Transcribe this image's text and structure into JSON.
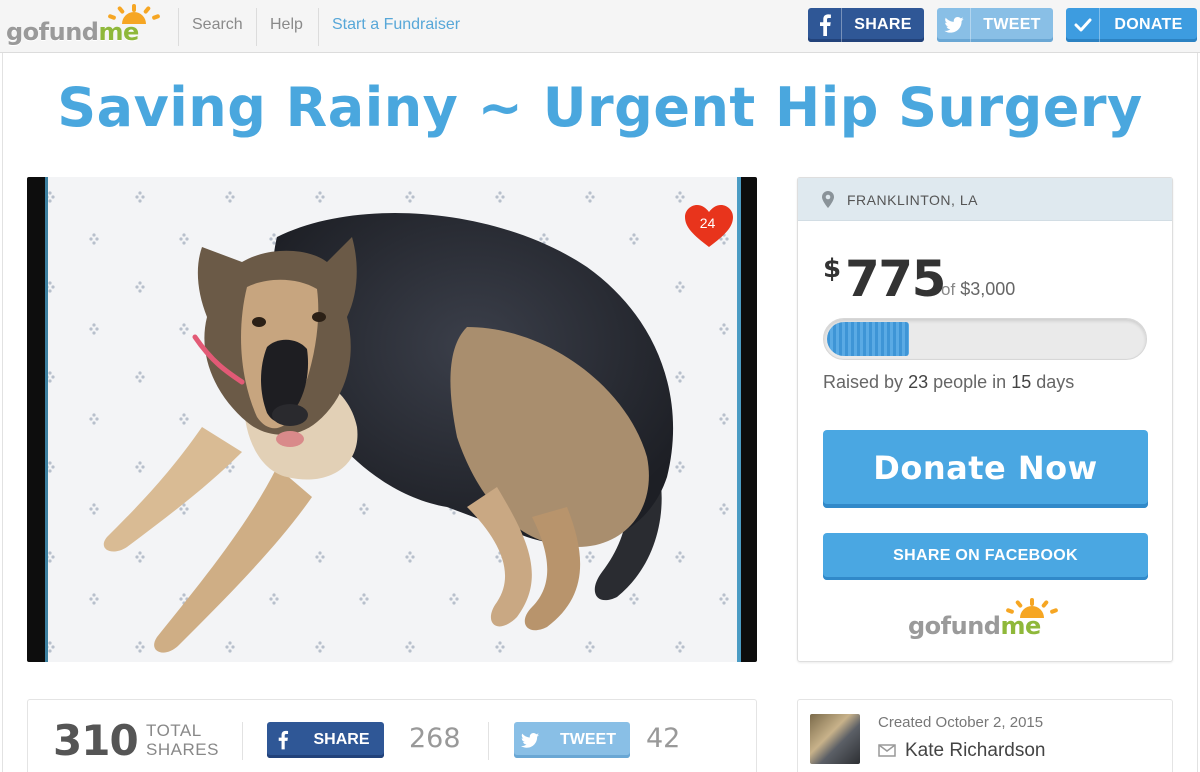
{
  "nav": {
    "logo_text_a": "gofund",
    "logo_text_b": "me",
    "links": [
      "Search",
      "Help",
      "Start a Fundraiser"
    ],
    "share_label": "SHARE",
    "tweet_label": "TWEET",
    "donate_label": "DONATE"
  },
  "campaign": {
    "title": "Saving Rainy ~ Urgent Hip Surgery",
    "hearts": "24",
    "location": "FRANKLINTON, LA",
    "raised_amount": "775",
    "goal_of": "of",
    "goal": "$3,000",
    "progress_fraction": 0.258,
    "raised_by_prefix": "Raised by",
    "people_count": "23",
    "people_mid": "people in",
    "days_count": "15",
    "days_suffix": "days",
    "donate_button": "Donate Now",
    "share_facebook_button": "SHARE ON FACEBOOK"
  },
  "shares": {
    "total": "310",
    "total_label_1": "TOTAL",
    "total_label_2": "SHARES",
    "fb_label": "SHARE",
    "fb_count": "268",
    "tw_label": "TWEET",
    "tw_count": "42"
  },
  "organizer": {
    "created": "Created October 2, 2015",
    "name": "Kate Richardson"
  },
  "colors": {
    "brand_blue": "#4aa7e2",
    "facebook": "#2f5796",
    "twitter": "#89bfe6",
    "logo_green": "#8fb83a",
    "logo_sun": "#f6a623",
    "heart": "#e8341c"
  },
  "icons": [
    "facebook-icon",
    "twitter-icon",
    "check-icon",
    "location-pin-icon",
    "heart-icon",
    "mail-icon",
    "sun-icon"
  ]
}
